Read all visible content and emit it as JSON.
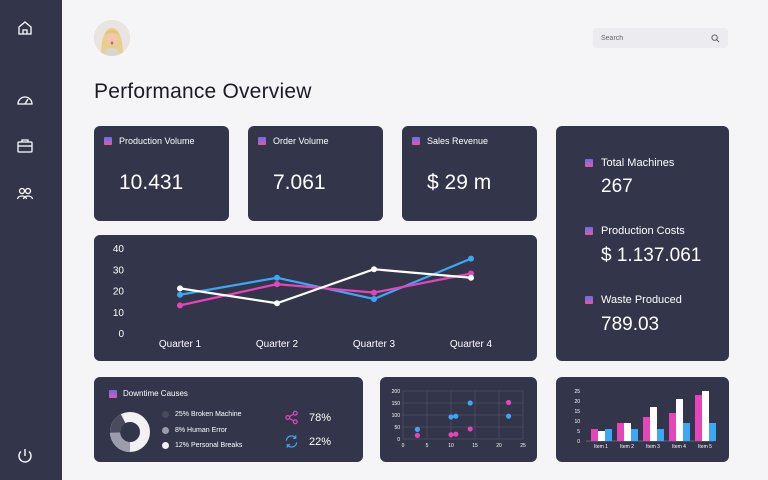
{
  "header": {
    "title": "Performance Overview",
    "search_placeholder": "Search"
  },
  "kpis": [
    {
      "label": "Production Volume",
      "value": "10.431"
    },
    {
      "label": "Order Volume",
      "value": "7.061"
    },
    {
      "label": "Sales Revenue",
      "value": "$ 29 m"
    }
  ],
  "side_stats": [
    {
      "label": "Total Machines",
      "value": "267"
    },
    {
      "label": "Production Costs",
      "value": "$ 1.137.061"
    },
    {
      "label": "Waste Produced",
      "value": "789.03"
    }
  ],
  "downtime": {
    "title": "Downtime Causes",
    "items": [
      {
        "label": "25% Broken Machine",
        "color": "#4a4b5c"
      },
      {
        "label": "8% Human Error",
        "color": "#9c9cac"
      },
      {
        "label": "12% Personal Breaks",
        "color": "#f2f2f4"
      }
    ],
    "share_pct": "78%",
    "sync_pct": "22%"
  },
  "colors": {
    "blue": "#3aa8f5",
    "pink": "#e545b8",
    "white": "#ffffff",
    "card": "#33354a"
  },
  "chart_data": [
    {
      "type": "line",
      "categories": [
        "Quarter 1",
        "Quarter 2",
        "Quarter 3",
        "Quarter 4"
      ],
      "ylim": [
        0,
        40
      ],
      "yticks": [
        "0",
        "10",
        "20",
        "30",
        "40"
      ],
      "series": [
        {
          "color": "#3aa8f5",
          "values": [
            18,
            26,
            16,
            35
          ]
        },
        {
          "color": "#e545b8",
          "values": [
            13,
            23,
            19,
            28
          ]
        },
        {
          "color": "#ffffff",
          "values": [
            21,
            14,
            30,
            26
          ]
        }
      ]
    },
    {
      "type": "scatter",
      "xlim": [
        0,
        25
      ],
      "ylim": [
        0,
        200
      ],
      "xticks": [
        "0",
        "5",
        "10",
        "15",
        "20",
        "25"
      ],
      "yticks": [
        "0",
        "50",
        "100",
        "150",
        "200"
      ],
      "series": [
        {
          "color": "#3aa8f5",
          "points": [
            [
              3,
              40
            ],
            [
              10,
              92
            ],
            [
              11,
              95
            ],
            [
              14,
              150
            ],
            [
              22,
              95
            ]
          ]
        },
        {
          "color": "#e545b8",
          "points": [
            [
              3,
              15
            ],
            [
              10,
              18
            ],
            [
              11,
              20
            ],
            [
              14,
              42
            ],
            [
              22,
              152
            ]
          ]
        }
      ]
    },
    {
      "type": "bar",
      "categories": [
        "Item 1",
        "Item 2",
        "Item 3",
        "Item 4",
        "Item 5"
      ],
      "ylim": [
        0,
        25
      ],
      "yticks": [
        "0",
        "5",
        "10",
        "15",
        "20",
        "25"
      ],
      "series": [
        {
          "color": "#ffffff",
          "values": [
            5,
            9,
            17,
            21,
            25
          ]
        },
        {
          "color": "#e545b8",
          "values": [
            6,
            9,
            12,
            14,
            23
          ]
        },
        {
          "color": "#3aa8f5",
          "values": [
            6,
            6,
            6,
            9,
            9
          ]
        }
      ]
    }
  ]
}
